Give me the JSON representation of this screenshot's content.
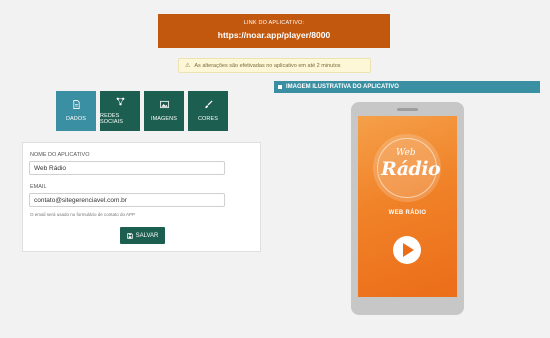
{
  "banner": {
    "label": "LINK DO APLICATIVO:",
    "url": "https://noar.app/player/8000"
  },
  "alert": {
    "icon": "warning-icon",
    "text": "As alterações são efetivadas no aplicativo em até 2 minutos"
  },
  "tabs": [
    {
      "label": "DADOS",
      "icon": "document-icon",
      "active": true
    },
    {
      "label": "REDES SOCIAIS",
      "icon": "share-icon",
      "active": false
    },
    {
      "label": "IMAGENS",
      "icon": "image-icon",
      "active": false
    },
    {
      "label": "CORES",
      "icon": "brush-icon",
      "active": false
    }
  ],
  "form": {
    "app_name_label": "NOME DO APLICATIVO",
    "app_name_value": "Web Rádio",
    "email_label": "EMAIL",
    "email_value": "contato@sitegerenciavel.com.br",
    "email_help": "O email será usado no formulário de contato do APP",
    "save_label": "SALVAR"
  },
  "preview": {
    "header": "IMAGEM ILUSTRATIVA DO APLICATIVO",
    "logo_small": "Web",
    "logo_big": "Rádio",
    "app_name": "WEB RÁDIO"
  },
  "colors": {
    "banner": "#c2570e",
    "tab": "#1c5f50",
    "tab_active": "#3a8fa2",
    "accent_orange": "#f08228"
  }
}
